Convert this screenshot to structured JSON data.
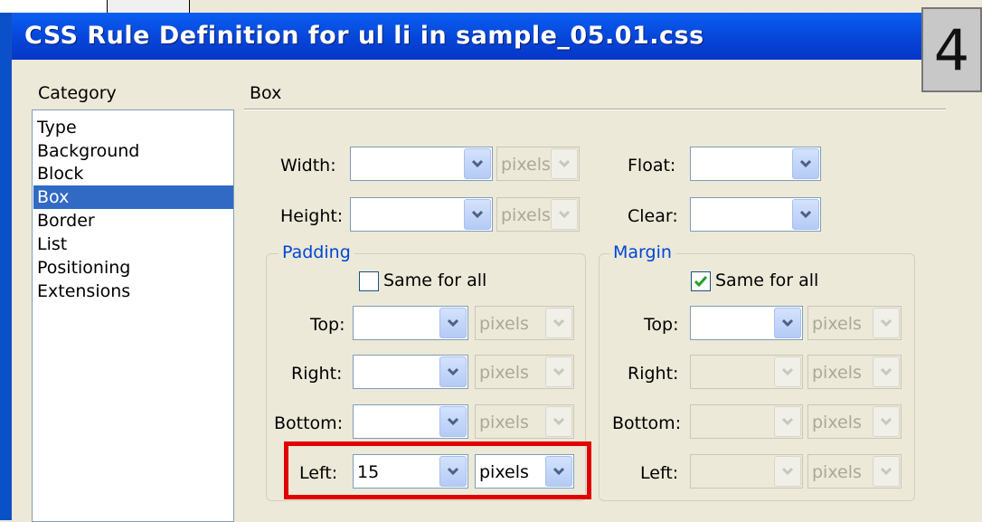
{
  "window": {
    "title": "CSS Rule Definition for ul li in sample_05.01.css",
    "step_badge": "4"
  },
  "category": {
    "label": "Category",
    "items": [
      "Type",
      "Background",
      "Block",
      "Box",
      "Border",
      "List",
      "Positioning",
      "Extensions"
    ],
    "selected": "Box"
  },
  "section": {
    "title": "Box"
  },
  "box": {
    "width": {
      "label": "Width:",
      "value": "",
      "unit": "pixels"
    },
    "height": {
      "label": "Height:",
      "value": "",
      "unit": "pixels"
    },
    "float": {
      "label": "Float:",
      "value": ""
    },
    "clear": {
      "label": "Clear:",
      "value": ""
    }
  },
  "padding": {
    "legend": "Padding",
    "same_for_all_label": "Same for all",
    "same_for_all_checked": false,
    "top": {
      "label": "Top:",
      "value": "",
      "unit": "pixels"
    },
    "right": {
      "label": "Right:",
      "value": "",
      "unit": "pixels"
    },
    "bottom": {
      "label": "Bottom:",
      "value": "",
      "unit": "pixels"
    },
    "left": {
      "label": "Left:",
      "value": "15",
      "unit": "pixels"
    }
  },
  "margin": {
    "legend": "Margin",
    "same_for_all_label": "Same for all",
    "same_for_all_checked": true,
    "top": {
      "label": "Top:",
      "value": "",
      "unit": "pixels"
    },
    "right": {
      "label": "Right:",
      "value": "",
      "unit": "pixels"
    },
    "bottom": {
      "label": "Bottom:",
      "value": "",
      "unit": "pixels"
    },
    "left": {
      "label": "Left:",
      "value": "",
      "unit": "pixels"
    }
  },
  "colors": {
    "titlebar": "#0645d8",
    "selection": "#316ac5",
    "highlight": "#e00000",
    "legend": "#0046d5"
  }
}
